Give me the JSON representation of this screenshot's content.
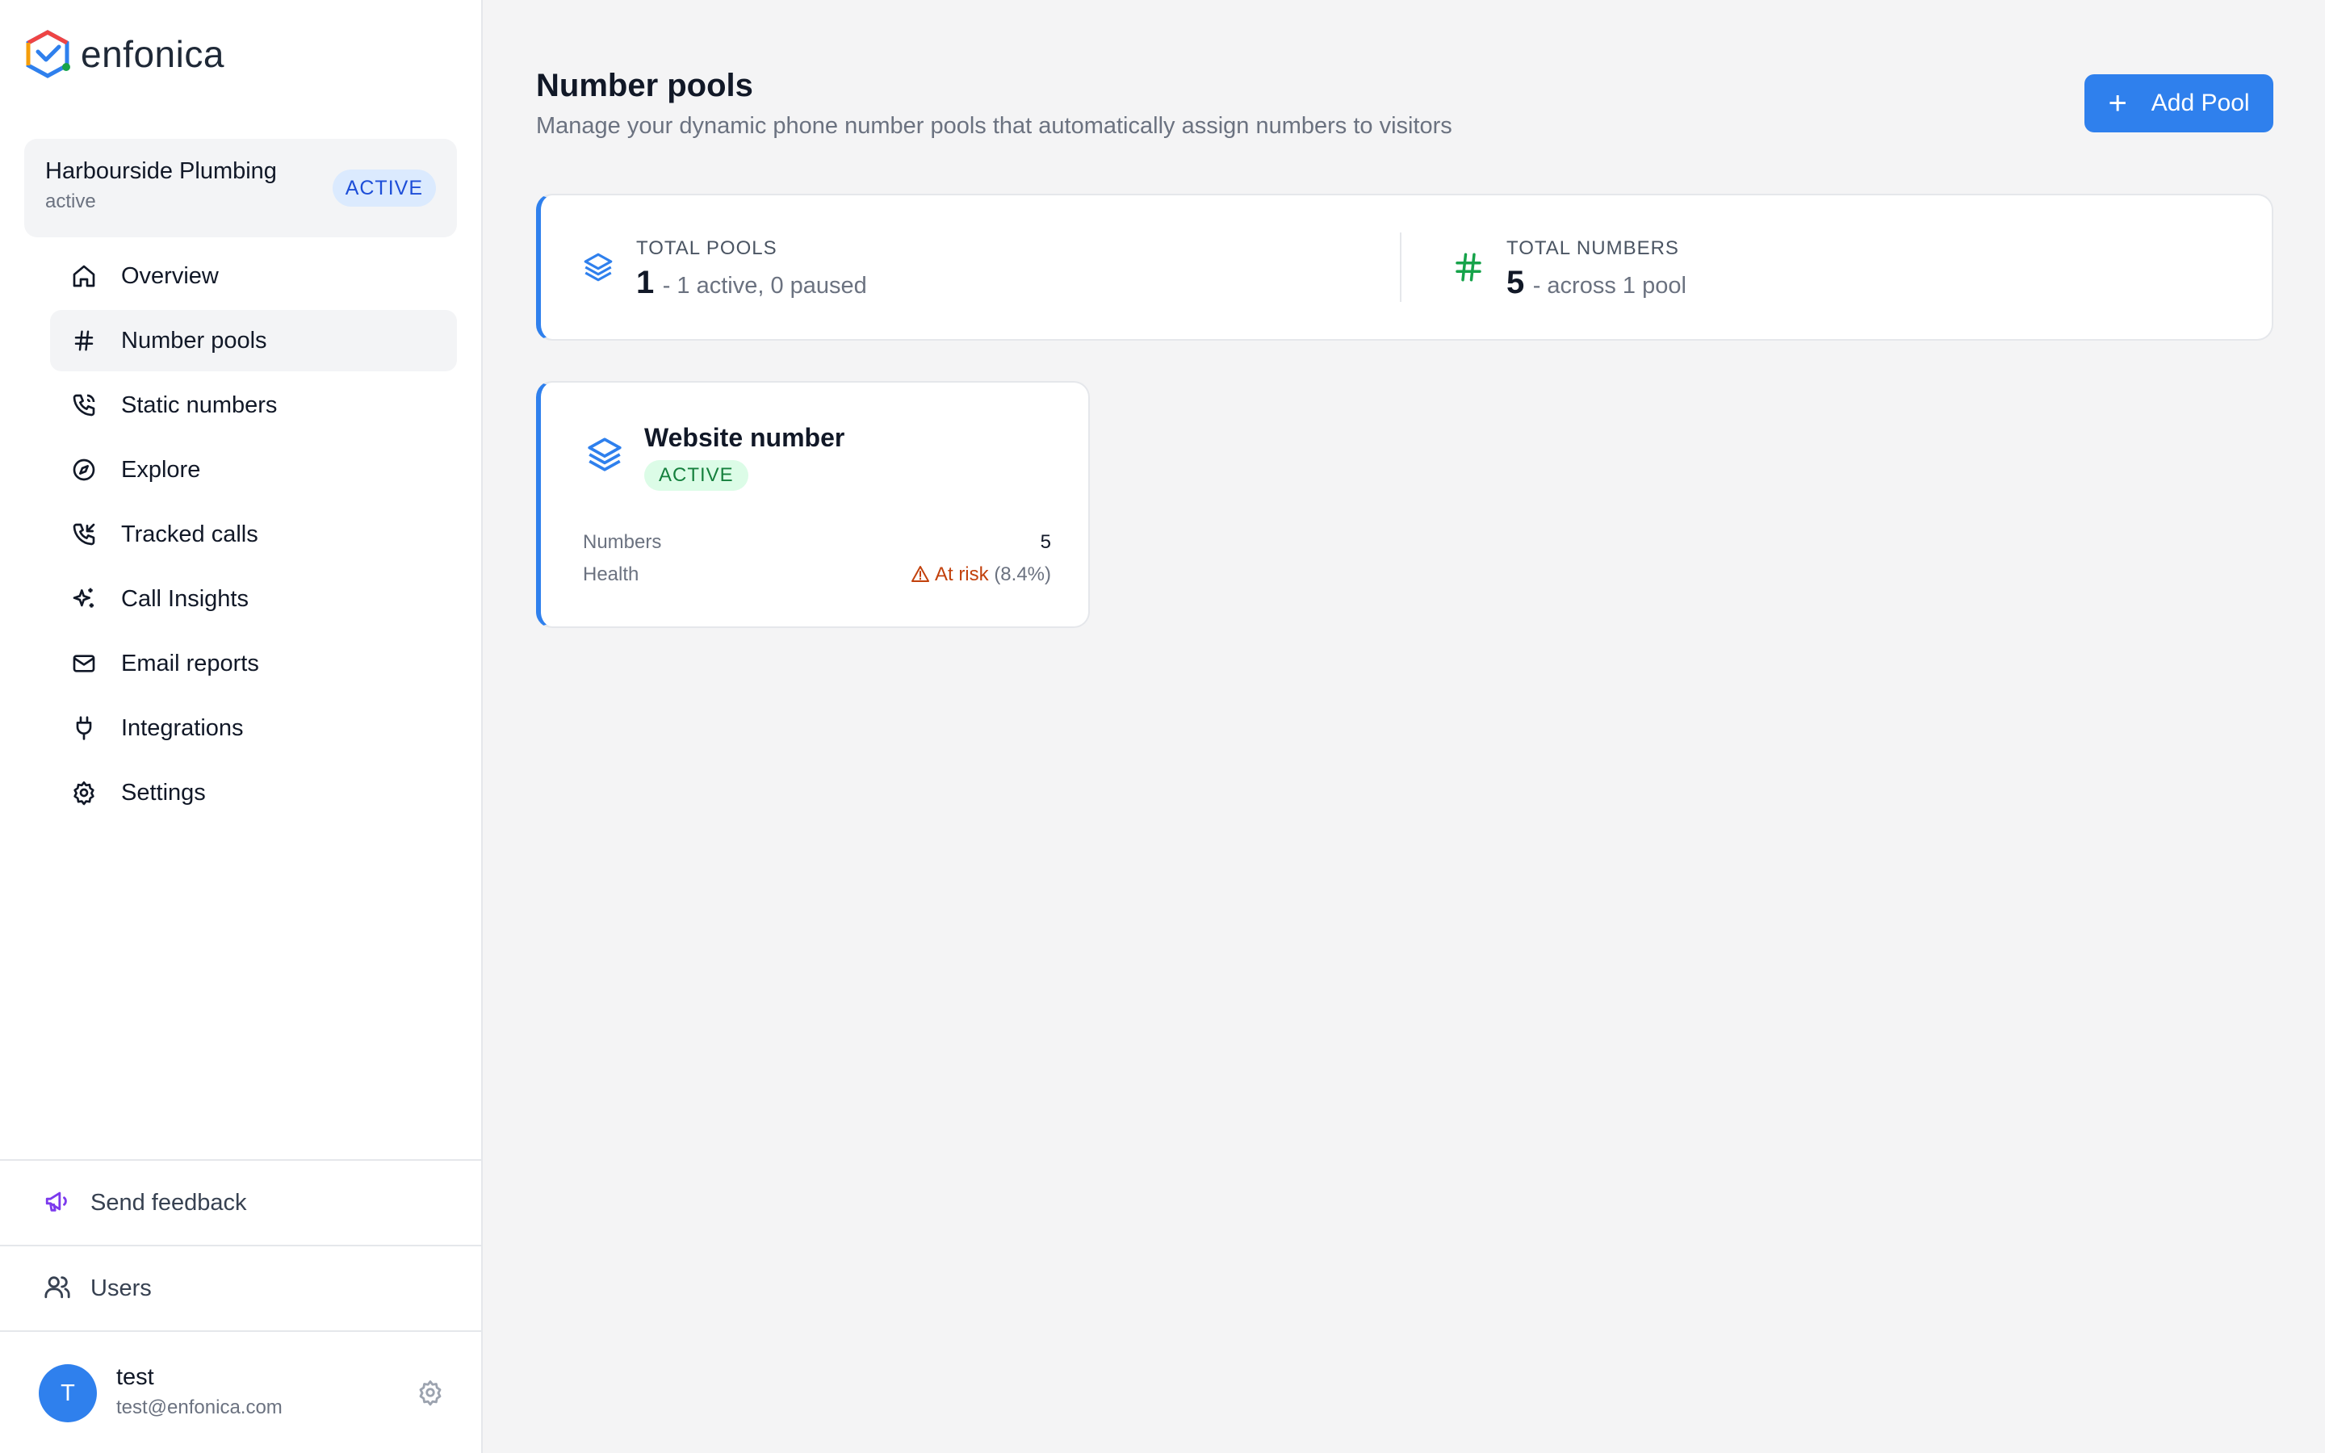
{
  "brand": {
    "name": "enfonica"
  },
  "account": {
    "name": "Harbourside Plumbing",
    "status": "active",
    "badge": "ACTIVE"
  },
  "nav": {
    "items": [
      {
        "label": "Overview",
        "icon": "home-icon",
        "active": false
      },
      {
        "label": "Number pools",
        "icon": "hash-icon",
        "active": true
      },
      {
        "label": "Static numbers",
        "icon": "phone-icon",
        "active": false
      },
      {
        "label": "Explore",
        "icon": "compass-icon",
        "active": false
      },
      {
        "label": "Tracked calls",
        "icon": "phone-incoming-icon",
        "active": false
      },
      {
        "label": "Call Insights",
        "icon": "sparkles-icon",
        "active": false
      },
      {
        "label": "Email reports",
        "icon": "mail-icon",
        "active": false
      },
      {
        "label": "Integrations",
        "icon": "plug-icon",
        "active": false
      },
      {
        "label": "Settings",
        "icon": "gear-icon",
        "active": false
      }
    ]
  },
  "sidebar_bottom": {
    "feedback_label": "Send feedback",
    "users_label": "Users"
  },
  "user": {
    "initial": "T",
    "name": "test",
    "email": "test@enfonica.com"
  },
  "page": {
    "title": "Number pools",
    "subtitle": "Manage your dynamic phone number pools that automatically assign numbers to visitors",
    "add_button_label": "Add Pool"
  },
  "stats": {
    "total_pools": {
      "label": "TOTAL POOLS",
      "value": "1",
      "desc": "- 1 active, 0 paused"
    },
    "total_numbers": {
      "label": "TOTAL NUMBERS",
      "value": "5",
      "desc": "- across 1 pool"
    }
  },
  "pools": [
    {
      "name": "Website number",
      "badge": "ACTIVE",
      "numbers_label": "Numbers",
      "numbers_value": "5",
      "health_label": "Health",
      "health_status": "At risk",
      "health_pct": "(8.4%)"
    }
  ],
  "colors": {
    "accent": "#2f80ed",
    "success": "#16a34a",
    "warning": "#c2410c"
  }
}
